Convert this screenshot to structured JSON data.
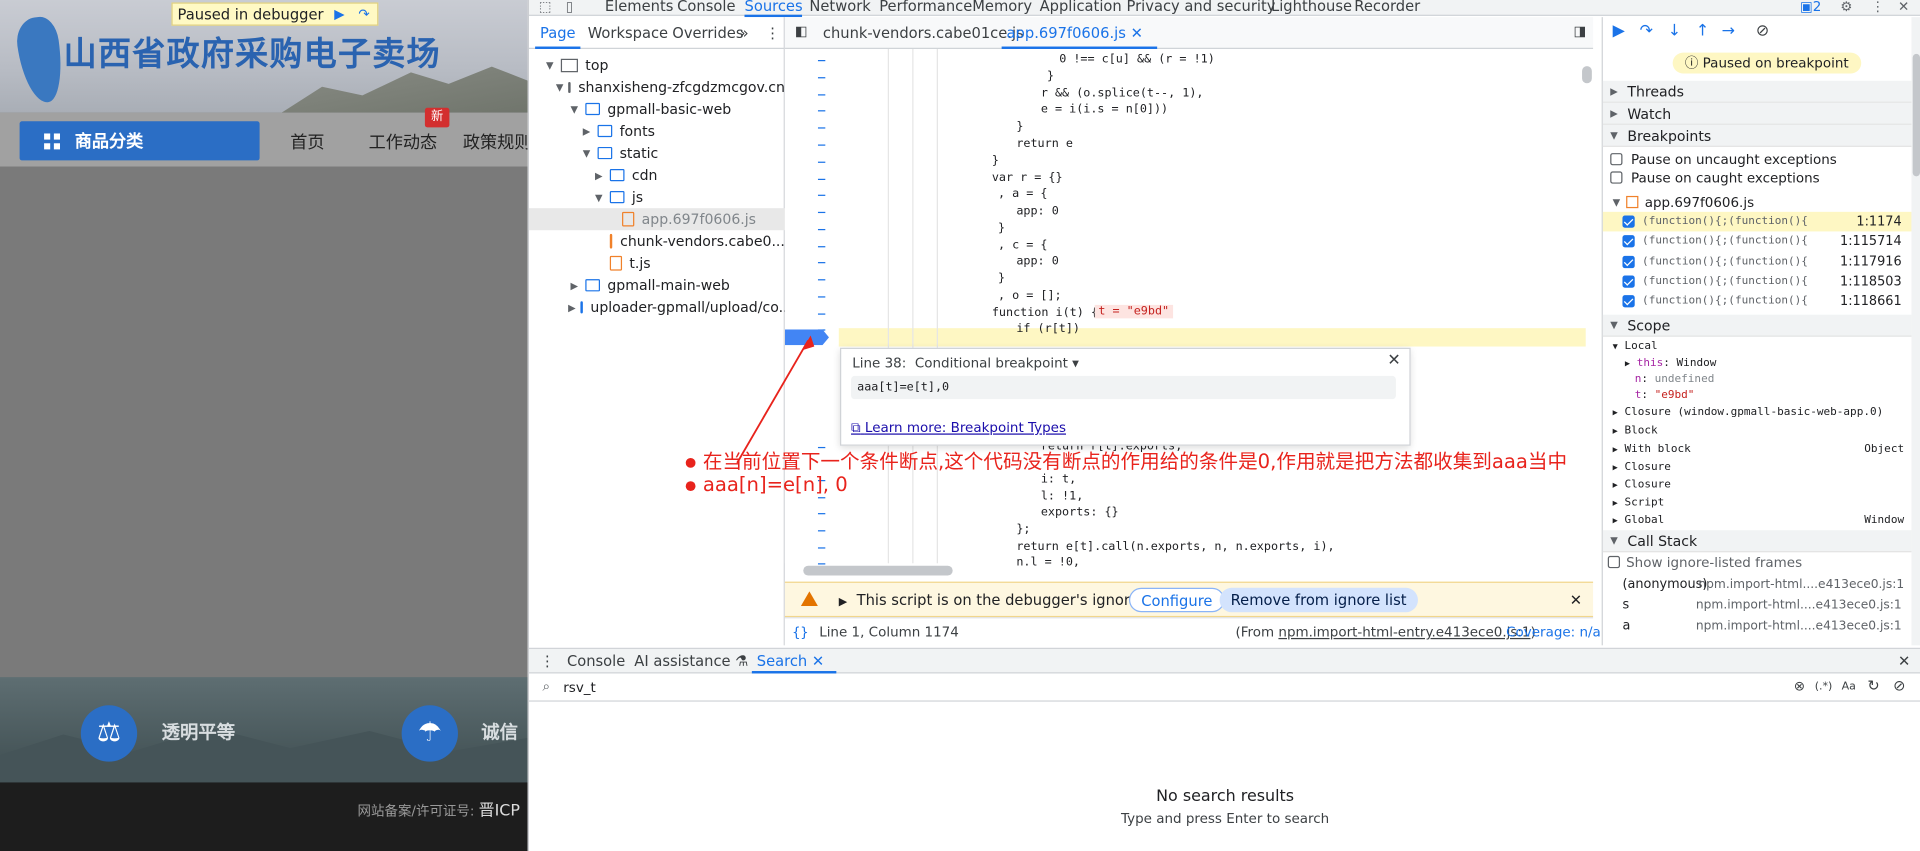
{
  "site": {
    "title": "山西省政府采购电子卖场",
    "paused_label": "Paused in debugger",
    "category_button": "商品分类",
    "nav": [
      "首页",
      "工作动态",
      "政策规则"
    ],
    "new_badge": "新",
    "features": [
      "透明平等",
      "诚信"
    ],
    "footer_text": "网站备案/许可证号:",
    "footer_icp": "晋ICP"
  },
  "devtools": {
    "panel_tabs": [
      "Elements",
      "Console",
      "Sources",
      "Network",
      "Performance",
      "Memory",
      "Application",
      "Privacy and security",
      "Lighthouse",
      "Recorder"
    ],
    "active_panel": "Sources",
    "issues_count": "2",
    "navigator_tabs": [
      "Page",
      "Workspace",
      "Overrides"
    ],
    "tree": [
      {
        "label": "top",
        "indent": 0,
        "icon": "frame",
        "twisty": "▼"
      },
      {
        "label": "shanxisheng-zfcgdzmcgov.cn",
        "indent": 1,
        "icon": "cloud",
        "twisty": "▼"
      },
      {
        "label": "gpmall-basic-web",
        "indent": 2,
        "icon": "folder",
        "twisty": "▼"
      },
      {
        "label": "fonts",
        "indent": 3,
        "icon": "folder",
        "twisty": "▶"
      },
      {
        "label": "static",
        "indent": 3,
        "icon": "folder",
        "twisty": "▼"
      },
      {
        "label": "cdn",
        "indent": 4,
        "icon": "folder",
        "twisty": "▶"
      },
      {
        "label": "js",
        "indent": 4,
        "icon": "folder",
        "twisty": "▼"
      },
      {
        "label": "app.697f0606.js",
        "indent": 5,
        "icon": "file",
        "twisty": ""
      },
      {
        "label": "chunk-vendors.cabe0...",
        "indent": 5,
        "icon": "file",
        "twisty": ""
      },
      {
        "label": "t.js",
        "indent": 4,
        "icon": "file",
        "twisty": ""
      },
      {
        "label": "gpmall-main-web",
        "indent": 2,
        "icon": "folder",
        "twisty": "▶"
      },
      {
        "label": "uploader-gpmall/upload/co...",
        "indent": 2,
        "icon": "folder",
        "twisty": "▶"
      }
    ],
    "editor_tabs": [
      "chunk-vendors.cabe01ce.js",
      "app.697f0606.js"
    ],
    "code_lines": [
      "0 !== c[u] && (r = !1)",
      "}",
      "r && (o.splice(t--, 1),",
      "e = i(i.s = n[0]))",
      "}",
      "return e",
      "}",
      "var r = {}",
      ", a = {",
      "app: 0",
      "}",
      ", c = {",
      "app: 0",
      "}",
      ", o = [];",
      "function i(t) {",
      "if (r[t])",
      "return r[t].exports;",
      "i: t,",
      "l: !1,",
      "exports: {}",
      "};",
      "return e[t].call(n.exports, n, n.exports, i),",
      "n.l = !0,"
    ],
    "inline_value": "t = \"e9bd\"",
    "conditional_bp": {
      "title": "Line 38:",
      "type": "Conditional breakpoint",
      "condition": "aaa[t]=e[t],0",
      "learn_more": "Learn more: Breakpoint Types"
    },
    "ignore_bar": {
      "message": "This script is on the debugger's ignore list",
      "configure": "Configure",
      "remove": "Remove from ignore list"
    },
    "status": {
      "position": "Line 1, Column 1174",
      "from_prefix": "(From ",
      "from_link": "npm.import-html-entry.e413ece0.js:1",
      "from_suffix": ")",
      "coverage": "Coverage: n/a"
    },
    "sidebar": {
      "paused_banner": "Paused on breakpoint",
      "sections": [
        "Threads",
        "Watch",
        "Breakpoints",
        "Scope",
        "Call Stack"
      ],
      "pause_uncaught": "Pause on uncaught exceptions",
      "pause_caught": "Pause on caught exceptions",
      "bp_file": "app.697f0606.js",
      "breakpoints": [
        {
          "src": "(function(){;(function(){with(th...",
          "loc": "1:1174"
        },
        {
          "src": "(function(){;(function(){with...",
          "loc": "1:115714"
        },
        {
          "src": "(function(){;(function(){with...",
          "loc": "1:117916"
        },
        {
          "src": "(function(){;(function(){with...",
          "loc": "1:118503"
        },
        {
          "src": "(function(){;(function(){with...",
          "loc": "1:118661"
        }
      ],
      "scope": {
        "local": "Local",
        "this_key": "this",
        "this_val": "Window",
        "n_key": "n",
        "n_val": "undefined",
        "t_key": "t",
        "t_val": "\"e9bd\"",
        "closure1": "Closure (window.gpmall-basic-web-app.0)",
        "block": "Block",
        "with_block": "With block",
        "with_val": "Object",
        "closure2": "Closure",
        "closure3": "Closure",
        "script": "Script",
        "global": "Global",
        "global_val": "Window"
      },
      "show_ignore": "Show ignore-listed frames",
      "call_stack": [
        {
          "fn": "(anonymous)",
          "src": "npm.import-html....e413ece0.js:1"
        },
        {
          "fn": "s",
          "src": "npm.import-html....e413ece0.js:1"
        },
        {
          "fn": "a",
          "src": "npm.import-html....e413ece0.js:1"
        }
      ]
    },
    "drawer": {
      "tabs": [
        "Console",
        "AI assistance",
        "Search"
      ],
      "search_value": "rsv_t",
      "regex_label": "(.*)",
      "case_label": "Aa",
      "no_results": "No search results",
      "hint": "Type and press Enter to search"
    }
  },
  "annotation": {
    "line1": "在当前位置下一个条件断点,这个代码没有断点的作用给的条件是0,作用就是把方法都收集到aaa当中",
    "line2": "aaa[n]=e[n], 0",
    "color": "#e8231c"
  }
}
